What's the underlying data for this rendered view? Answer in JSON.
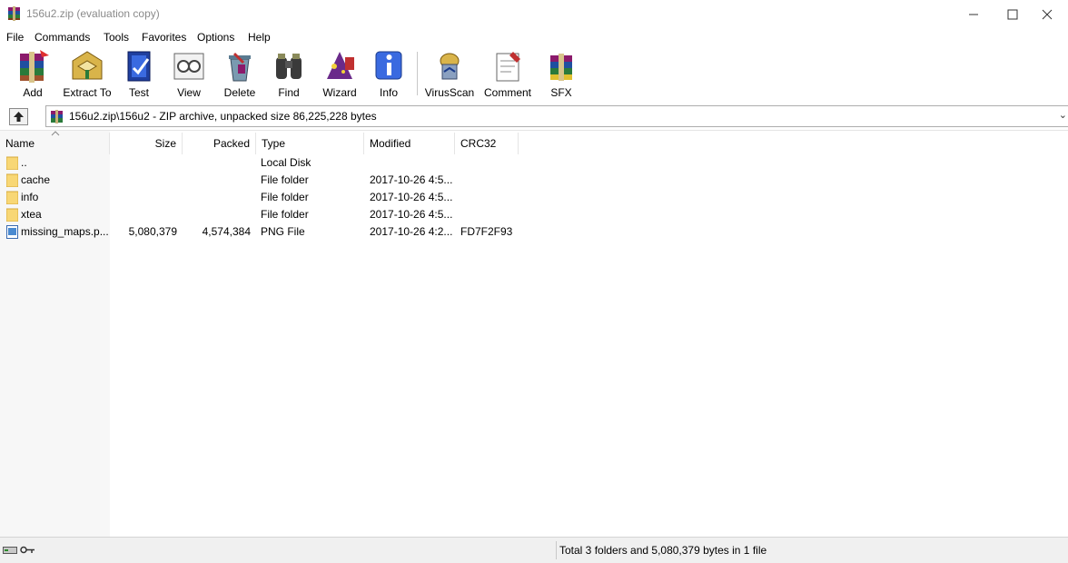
{
  "window": {
    "title": "156u2.zip (evaluation copy)"
  },
  "menu": [
    "File",
    "Commands",
    "Tools",
    "Favorites",
    "Options",
    "Help"
  ],
  "toolbar": [
    {
      "label": "Add",
      "icon": "add-icon"
    },
    {
      "label": "Extract To",
      "icon": "extract-icon"
    },
    {
      "label": "Test",
      "icon": "test-icon"
    },
    {
      "label": "View",
      "icon": "view-icon"
    },
    {
      "label": "Delete",
      "icon": "delete-icon"
    },
    {
      "label": "Find",
      "icon": "find-icon"
    },
    {
      "label": "Wizard",
      "icon": "wizard-icon"
    },
    {
      "label": "Info",
      "icon": "info-icon"
    },
    {
      "label": "VirusScan",
      "icon": "virusscan-icon"
    },
    {
      "label": "Comment",
      "icon": "comment-icon"
    },
    {
      "label": "SFX",
      "icon": "sfx-icon"
    }
  ],
  "address": {
    "path": "156u2.zip\\156u2 - ZIP archive, unpacked size 86,225,228 bytes"
  },
  "columns": [
    "Name",
    "Size",
    "Packed",
    "Type",
    "Modified",
    "CRC32"
  ],
  "files": [
    {
      "name": "..",
      "size": "",
      "packed": "",
      "type": "Local Disk",
      "modified": "",
      "crc": "",
      "icon": "folder-icon"
    },
    {
      "name": "cache",
      "size": "",
      "packed": "",
      "type": "File folder",
      "modified": "2017-10-26 4:5...",
      "crc": "",
      "icon": "folder-icon"
    },
    {
      "name": "info",
      "size": "",
      "packed": "",
      "type": "File folder",
      "modified": "2017-10-26 4:5...",
      "crc": "",
      "icon": "folder-icon"
    },
    {
      "name": "xtea",
      "size": "",
      "packed": "",
      "type": "File folder",
      "modified": "2017-10-26 4:5...",
      "crc": "",
      "icon": "folder-icon"
    },
    {
      "name": "missing_maps.p...",
      "size": "5,080,379",
      "packed": "4,574,384",
      "type": "PNG File",
      "modified": "2017-10-26 4:2...",
      "crc": "FD7F2F93",
      "icon": "png-file-icon"
    }
  ],
  "status": {
    "text": "Total 3 folders and 5,080,379 bytes in 1 file"
  }
}
